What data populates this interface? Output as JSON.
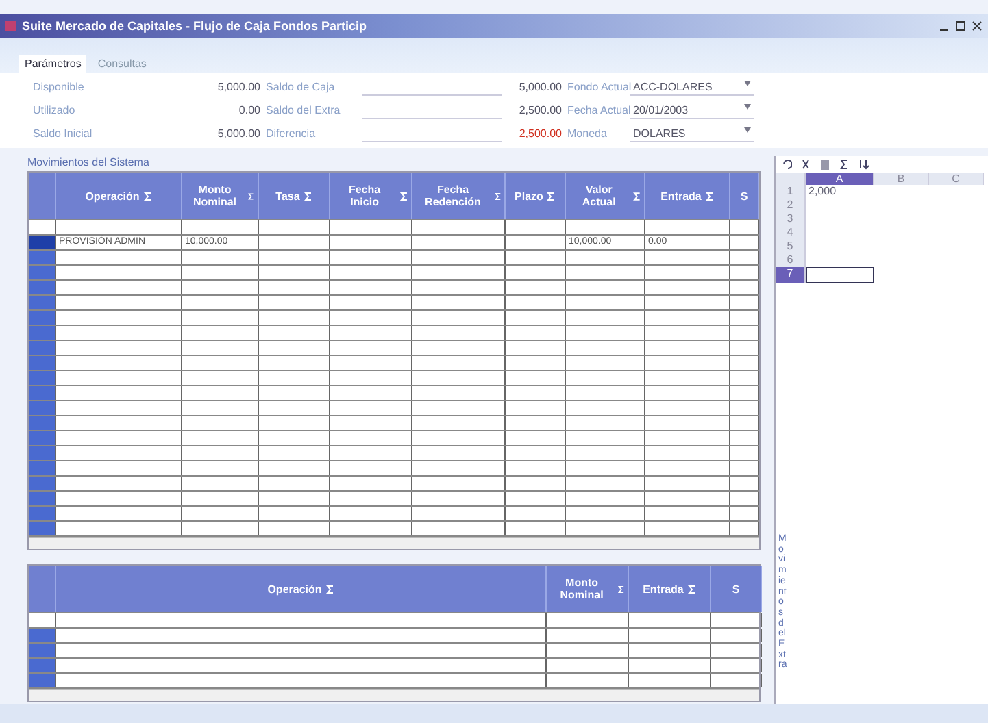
{
  "window": {
    "title": "Suite Mercado de Capitales - Flujo de Caja Fondos Particip"
  },
  "tabs": [
    {
      "label": "Parámetros",
      "selected": true
    },
    {
      "label": "Consultas",
      "selected": false
    }
  ],
  "params": [
    {
      "label": "Disponible",
      "amount": "5,000.00",
      "label_2": "Saldo de Caja",
      "amount_2": "5,000.00",
      "alert": false,
      "label_3": "Fondo Actual",
      "select": "ACC-DOLARES"
    },
    {
      "label": "Utilizado",
      "amount": "0.00",
      "label_2": "Saldo del Extra",
      "amount_2": "2,500.00",
      "alert": false,
      "label_3": "Fecha Actual",
      "select": "20/01/2003"
    },
    {
      "label": "Saldo Inicial",
      "amount": "5,000.00",
      "label_2": "Diferencia",
      "amount_2": "2,500.00",
      "alert": true,
      "label_3": "Moneda",
      "select": "DOLARES"
    }
  ],
  "system_grid": {
    "caption": "Movimientos del Sistema",
    "columns": [
      "Operación",
      "Monto Nominal",
      "Tasa",
      "Fecha Inicio",
      "Fecha Redención",
      "Plazo",
      "Valor Actual",
      "Entrada",
      "S"
    ],
    "rows": [
      {
        "selected": true,
        "cells": [
          "PROVISIÓN ADMIN",
          "10,000.00",
          "",
          "",
          "",
          "",
          "10,000.00",
          "0.00",
          ""
        ]
      }
    ]
  },
  "sheet": {
    "columns": [
      "A",
      "B",
      "C"
    ],
    "rows": [
      {
        "number": "1",
        "value": "2,000",
        "selected": false
      },
      {
        "number": "2",
        "value": "",
        "selected": false
      },
      {
        "number": "3",
        "value": "",
        "selected": false
      },
      {
        "number": "4",
        "value": "",
        "selected": false
      },
      {
        "number": "5",
        "value": "",
        "selected": false
      },
      {
        "number": "6",
        "value": "",
        "selected": false
      },
      {
        "number": "7",
        "value": "",
        "selected": true
      }
    ]
  },
  "extra_grid": {
    "caption": "Movimientos del Extra",
    "columns": [
      "Operación",
      "Monto Nominal",
      "Entrada",
      "S"
    ]
  }
}
